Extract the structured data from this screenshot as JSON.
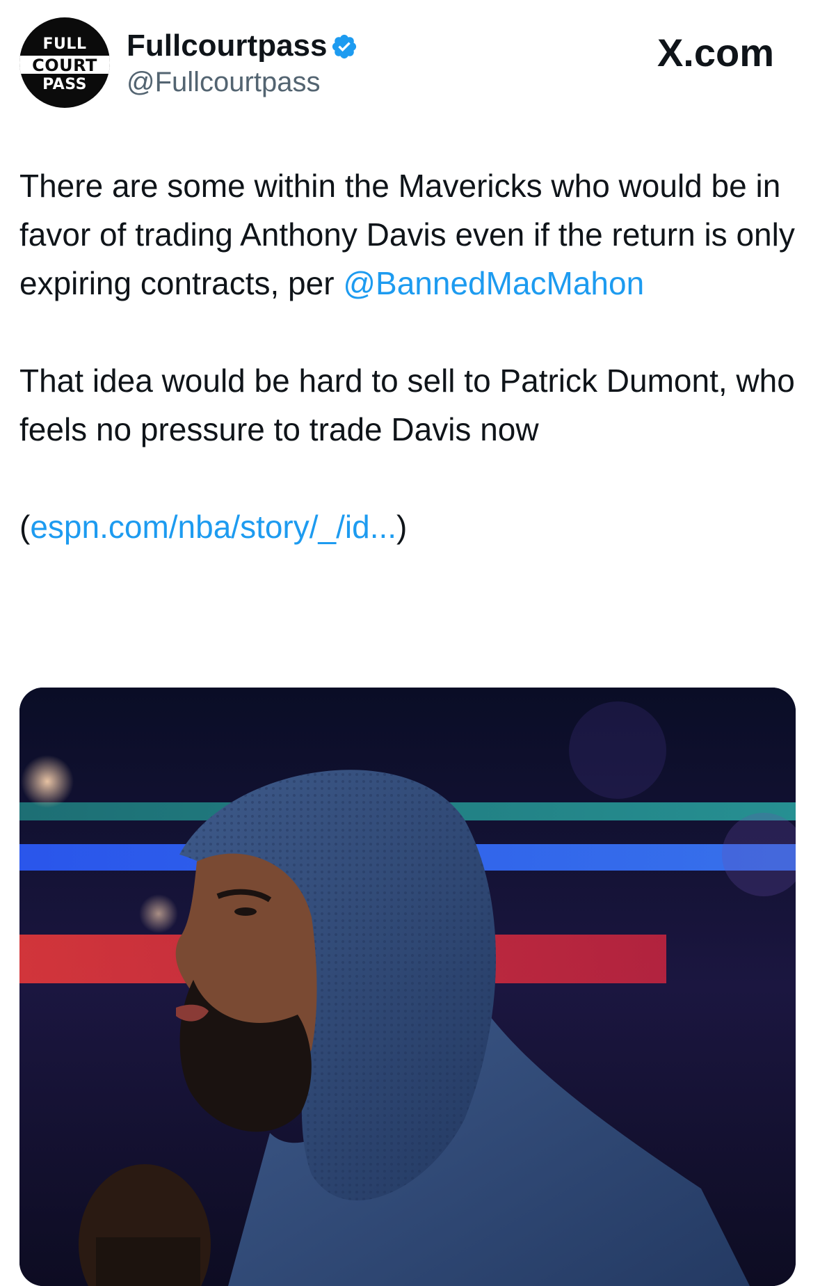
{
  "header": {
    "avatar_logo": [
      "FULL",
      "COURT",
      "PASS"
    ],
    "display_name": "Fullcourtpass",
    "handle": "@Fullcourtpass",
    "source_brand": "X.com"
  },
  "tweet": {
    "paragraph1_text": "There are some within the Mavericks who would be in favor of trading Anthony Davis even if the return is only expiring contracts, per ",
    "paragraph1_mention": "@BannedMacMahon",
    "paragraph2_text": "That idea would be hard to sell to Patrick Dumont, who feels no pressure to trade Davis now",
    "link_open": "(",
    "link_text": "espn.com/nba/story/_/id...",
    "link_close": ")"
  },
  "media": {
    "type": "photo",
    "subject": "man in navy blue hooded sweatshirt in arena"
  },
  "colors": {
    "link": "#1d9bf0",
    "verified": "#1d9bf0",
    "text": "#0f1419",
    "secondary_text": "#536471"
  },
  "icons": {
    "verified_badge": "verified-badge-icon",
    "brand": "x-logo-icon"
  }
}
